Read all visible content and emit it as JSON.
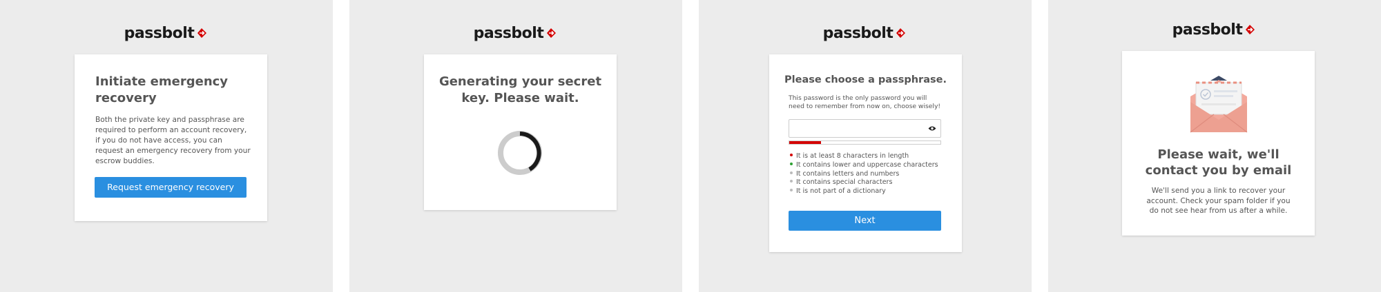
{
  "logo": {
    "text": "passbolt",
    "accent_color": "#d40101",
    "icon": "passbolt-arrow-icon"
  },
  "screens": [
    {
      "title": "Initiate emergency recovery",
      "description": "Both the private key and passphrase are required to perform an account recovery, if you do not have access, you can request an emergency recovery from your escrow buddies.",
      "button_label": "Request emergency recovery"
    },
    {
      "title": "Generating your secret key. Please wait.",
      "spinner_icon": "loading-spinner-icon"
    },
    {
      "title": "Please choose a passphrase.",
      "description": "This password is the only password you will need to remember from now on, choose wisely!",
      "passphrase_input": {
        "value": "",
        "placeholder": ""
      },
      "toggle_icon": "eye-icon",
      "strength_level": 0.21,
      "strength_color": "#d40101",
      "criteria": [
        {
          "text": "It is at least 8 characters in length",
          "status": "failed"
        },
        {
          "text": "It contains lower and uppercase characters",
          "status": "success"
        },
        {
          "text": "It contains letters and numbers",
          "status": "pending"
        },
        {
          "text": "It contains special characters",
          "status": "pending"
        },
        {
          "text": "It is not part of a dictionary",
          "status": "pending"
        }
      ],
      "button_label": "Next"
    },
    {
      "title": "Please wait, we'll contact you by email",
      "description": "We'll send you a link to recover your account. Check your spam folder if you do not see hear from us after a while.",
      "illustration_icon": "envelope-illustration-icon"
    }
  ],
  "colors": {
    "primary": "#2a8fe0",
    "failed": "#d40101",
    "success": "#2ea133",
    "pending": "#bbbbbb",
    "background": "#ececec"
  }
}
